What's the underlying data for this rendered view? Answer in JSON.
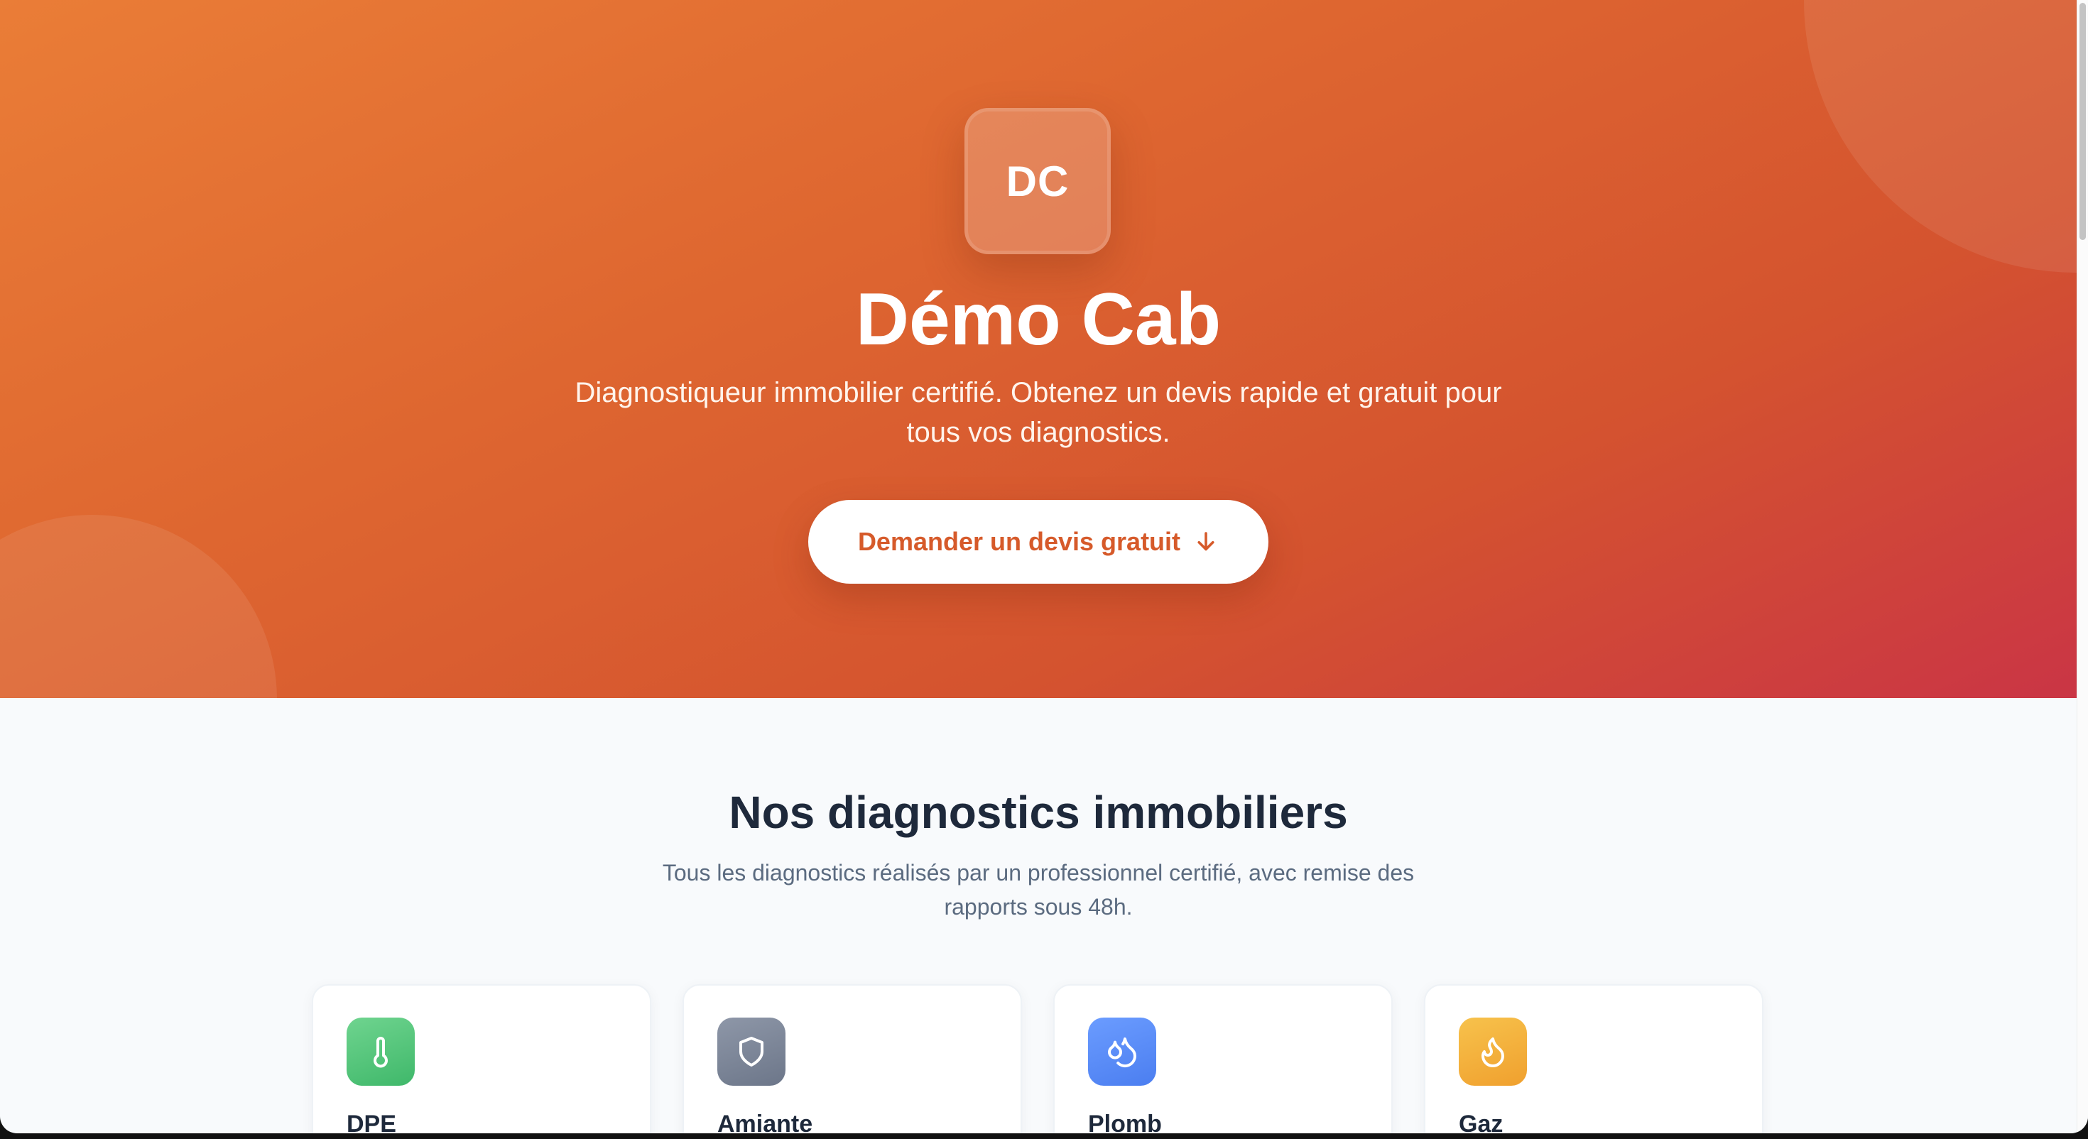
{
  "hero": {
    "logo_initials": "DC",
    "title": "Démo Cab",
    "subtitle": "Diagnostiqueur immobilier certifié. Obtenez un devis rapide et gratuit pour tous vos diagnostics.",
    "cta_label": "Demander un devis gratuit",
    "cta_icon": "arrow-down-icon",
    "gradient_colors": [
      "#ea7d37",
      "#d4532f",
      "#ca3545"
    ],
    "cta_text_color": "#d65a2a"
  },
  "services": {
    "title": "Nos diagnostics immobiliers",
    "subtitle": "Tous les diagnostics réalisés par un professionnel certifié, avec remise des rapports sous 48h.",
    "cards": [
      {
        "title": "DPE",
        "icon": "thermometer-icon",
        "color_from": "#6fd48f",
        "color_to": "#3fb86a"
      },
      {
        "title": "Amiante",
        "icon": "shield-icon",
        "color_from": "#8e97a8",
        "color_to": "#6c7689"
      },
      {
        "title": "Plomb",
        "icon": "droplets-icon",
        "color_from": "#6b9cff",
        "color_to": "#4b7ef0"
      },
      {
        "title": "Gaz",
        "icon": "flame-icon",
        "color_from": "#f7c24c",
        "color_to": "#f0a02e"
      }
    ]
  }
}
